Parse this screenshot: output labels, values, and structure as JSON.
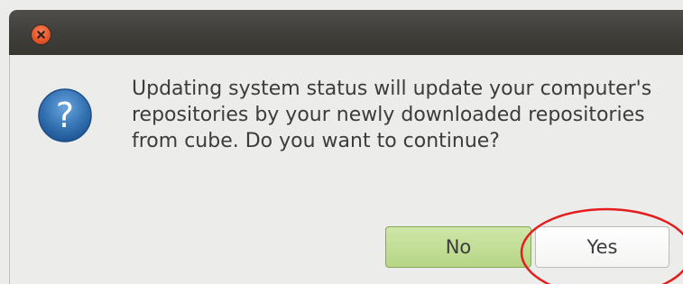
{
  "window": {
    "close_icon": "close-icon",
    "close_color": "#e8572c"
  },
  "dialog": {
    "icon": "question-icon",
    "icon_glyph": "?",
    "icon_color": "#2f6eab",
    "message": "Updating system status will update your computer's repositories by your newly downloaded repositories from cube. Do you want to continue?"
  },
  "buttons": {
    "no_label": "No",
    "yes_label": "Yes",
    "no_color": "#b6d687"
  },
  "annotation": {
    "highlight_color": "#e31c1c",
    "highlight_target": "yes-button"
  }
}
